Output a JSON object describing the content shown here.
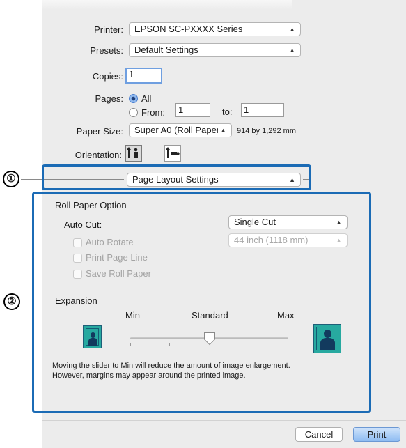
{
  "print": {
    "printer_label": "Printer:",
    "printer_value": "EPSON SC-PXXXX Series",
    "presets_label": "Presets:",
    "presets_value": "Default Settings",
    "copies_label": "Copies:",
    "copies_value": "1",
    "pages_label": "Pages:",
    "pages_all": "All",
    "pages_from": "From:",
    "pages_from_value": "1",
    "pages_to": "to:",
    "pages_to_value": "1",
    "paper_size_label": "Paper Size:",
    "paper_size_value": "Super A0 (Roll Paper...",
    "paper_size_dims": "914 by 1,292 mm",
    "orientation_label": "Orientation:",
    "panel_select": "Page Layout Settings"
  },
  "callouts": {
    "one": "①",
    "two": "②"
  },
  "roll": {
    "section_title": "Roll Paper Option",
    "auto_cut_label": "Auto Cut:",
    "auto_cut_value": "Single Cut",
    "width_value": "44 inch (1118 mm)",
    "auto_rotate": "Auto Rotate",
    "print_page_line": "Print Page Line",
    "save_roll_paper": "Save Roll Paper"
  },
  "expansion": {
    "title": "Expansion",
    "min": "Min",
    "standard": "Standard",
    "max": "Max",
    "level": 0.5,
    "note_line1": "Moving the slider to Min will reduce the amount of image enlargement.",
    "note_line2": "However, margins may appear around the printed image."
  },
  "buttons": {
    "cancel": "Cancel",
    "print": "Print"
  },
  "colors": {
    "callout": "#1b6bb5",
    "default_button": "#8ebcf2"
  },
  "icons": [
    "chevron-updown-icon",
    "portrait-orientation-icon",
    "landscape-orientation-icon",
    "small-image-icon",
    "large-image-icon"
  ]
}
